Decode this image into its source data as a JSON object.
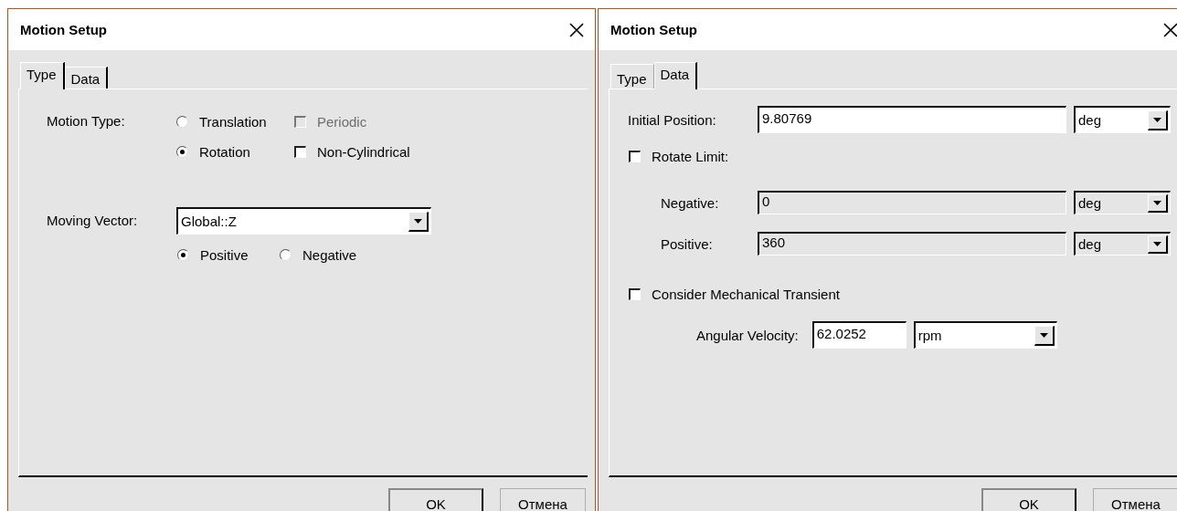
{
  "dialogs": [
    {
      "title": "Motion Setup",
      "tabs": [
        {
          "label": "Type",
          "selected": true
        },
        {
          "label": "Data",
          "selected": false
        }
      ],
      "page": {
        "kind": "type",
        "motion_type": {
          "label": "Motion Type:",
          "options": [
            {
              "label": "Translation",
              "selected": false
            },
            {
              "label": "Rotation",
              "selected": true
            }
          ],
          "checkboxes": [
            {
              "label": "Periodic",
              "checked": false,
              "disabled": true
            },
            {
              "label": "Non-Cylindrical",
              "checked": false,
              "disabled": false
            }
          ]
        },
        "moving_vector": {
          "label": "Moving Vector:",
          "value": "Global::Z",
          "directions": [
            {
              "label": "Positive",
              "selected": true
            },
            {
              "label": "Negative",
              "selected": false
            }
          ]
        }
      },
      "buttons": [
        "OK",
        "Отмена"
      ]
    },
    {
      "title": "Motion Setup",
      "tabs": [
        {
          "label": "Type",
          "selected": false
        },
        {
          "label": "Data",
          "selected": true
        }
      ],
      "page": {
        "kind": "data",
        "initial_position": {
          "label": "Initial Position:",
          "value": "9.80769",
          "unit": "deg"
        },
        "rotate_limit": {
          "label": "Rotate Limit:",
          "checked": false
        },
        "limits": [
          {
            "label": "Negative:",
            "value": "0",
            "unit": "deg",
            "disabled": true
          },
          {
            "label": "Positive:",
            "value": "360",
            "unit": "deg",
            "disabled": true
          }
        ],
        "transient": {
          "label": "Consider Mechanical Transient",
          "checked": false
        },
        "angular_velocity": {
          "label": "Angular Velocity:",
          "value": "62.0252",
          "unit": "rpm"
        }
      },
      "buttons": [
        "OK",
        "Отмена"
      ]
    }
  ]
}
